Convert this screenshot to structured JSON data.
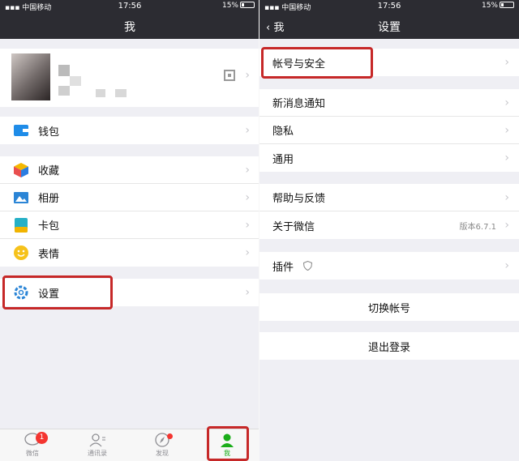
{
  "status_bar": {
    "carrier": "中国移动",
    "time": "17:56",
    "battery": "15%"
  },
  "left": {
    "nav_title": "我",
    "menu": {
      "wallet": "钱包",
      "favorites": "收藏",
      "album": "相册",
      "cards": "卡包",
      "stickers": "表情",
      "settings": "设置"
    },
    "tabbar": [
      {
        "label": "微信",
        "badge": "1"
      },
      {
        "label": "通讯录"
      },
      {
        "label": "发现"
      },
      {
        "label": "我"
      }
    ]
  },
  "right": {
    "nav_back": "我",
    "nav_title": "设置",
    "items": {
      "account_security": "帐号与安全",
      "new_message_notify": "新消息通知",
      "privacy": "隐私",
      "general": "通用",
      "help_feedback": "帮助与反馈",
      "about": "关于微信",
      "about_version": "版本6.7.1",
      "plugins": "插件",
      "switch_account": "切换帐号",
      "logout": "退出登录"
    }
  },
  "colors": {
    "nav_bg": "#2c2c32",
    "accent": "#1aad19",
    "highlight_box": "#c62828",
    "badge": "#f43530"
  }
}
